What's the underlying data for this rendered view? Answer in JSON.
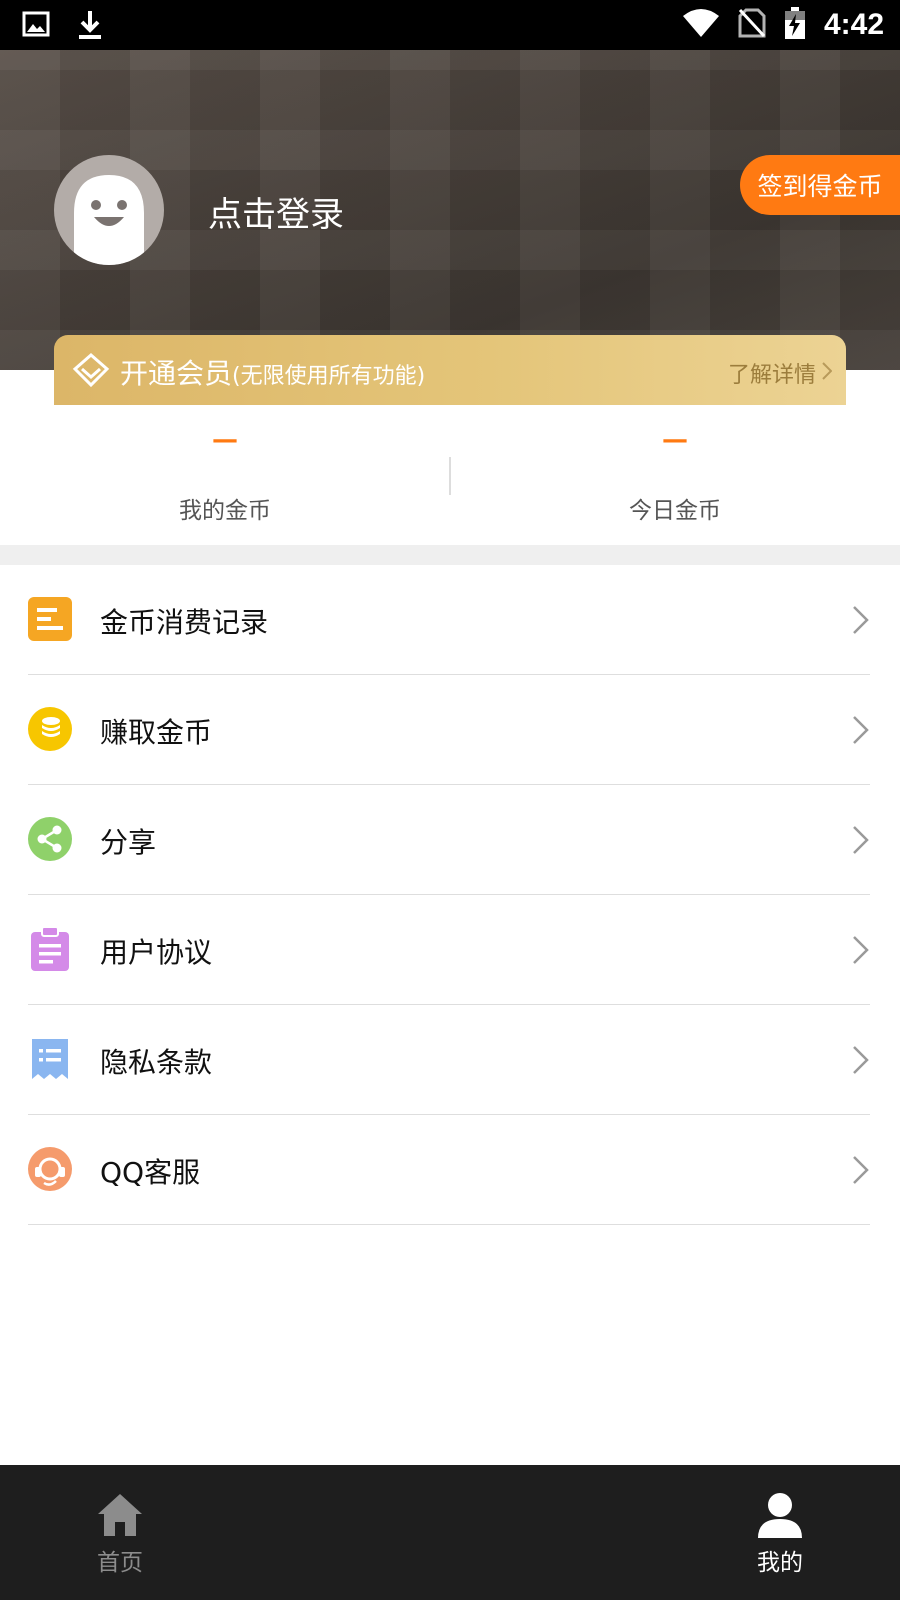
{
  "status_bar": {
    "time": "4:42",
    "icons": [
      "image-icon",
      "download-icon",
      "wifi-icon",
      "no-sim-icon",
      "battery-charging-icon"
    ]
  },
  "header": {
    "login_text": "点击登录",
    "checkin_button": "签到得金币"
  },
  "vip": {
    "title": "开通会员",
    "subtitle": "(无限使用所有功能)",
    "detail_link": "了解详情"
  },
  "coins": {
    "mine": {
      "value": "—",
      "label": "我的金币"
    },
    "today": {
      "value": "—",
      "label": "今日金币"
    }
  },
  "menu": [
    {
      "label": "金币消费记录",
      "icon": "record-list-icon",
      "color": "#f5a623"
    },
    {
      "label": "赚取金币",
      "icon": "coin-stack-icon",
      "color": "#f7c600"
    },
    {
      "label": "分享",
      "icon": "share-icon",
      "color": "#8fd16a"
    },
    {
      "label": "用户协议",
      "icon": "clipboard-icon",
      "color": "#d48ae8"
    },
    {
      "label": "隐私条款",
      "icon": "receipt-icon",
      "color": "#8ab6f0"
    },
    {
      "label": "QQ客服",
      "icon": "headset-icon",
      "color": "#f59b6c"
    }
  ],
  "bottom_nav": {
    "home_label": "首页",
    "mine_label": "我的",
    "active": "我的"
  },
  "colors": {
    "accent": "#ff7a12",
    "vip_gold": "#e4c579",
    "nav_bg": "#1e1e1e"
  }
}
